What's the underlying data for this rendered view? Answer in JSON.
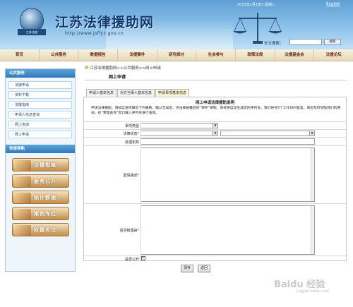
{
  "header": {
    "site_title": "江苏法律援助网",
    "site_url": "http://www.jsflyz.gov.cn",
    "emblem_text": "江苏法援",
    "date_text": "2011年1月18日 星期二",
    "lang_link": "English",
    "search_label": "全文搜索：",
    "search_value": "",
    "search_button": "搜索"
  },
  "nav": {
    "items": [
      "首页",
      "公共服务",
      "数据报告",
      "法援案件",
      "研究探讨",
      "社会参与",
      "政策法规",
      "法援基金会",
      "法援论坛"
    ]
  },
  "sidebar": {
    "public_service_title": "公共服务",
    "items": [
      "法援申请",
      "资料下载",
      "法援指南",
      "申请人信息查询",
      "网上咨询",
      "网上申请"
    ],
    "quick_nav_title": "快速导航",
    "quick_buttons": [
      "法援指南",
      "服务公开",
      "统计数据",
      "案例专栏",
      "权援关注"
    ]
  },
  "main": {
    "breadcrumb": "江苏法律援助网>>公共服务>>网上申请",
    "page_title": "网上申请",
    "tabs": [
      "申请人基本信息",
      "对方当事人基本信息",
      "申请事项基本信息"
    ],
    "active_tab_index": 2,
    "form_heading": "网上申请法律援助说明",
    "form_notice": "申请法律援助，请如实逐项填写下列表格，确认无误后，点击表格最后的“保存”按钮。系统将自动生成您的序列号，我们将在5个工作日内答复，请您及时登陆我们的网站，在“受理查询”窗口输入序列号进行查询。",
    "fields": {
      "matter_type_label": "事项类型",
      "legal_status_label": "法律状态",
      "handling_org_label": "处理机构",
      "case_description_label": "案情描述",
      "request_reason_label": "请求和理由",
      "public_label": "是否公开"
    },
    "public_checked": true,
    "buttons": {
      "save": "保存",
      "back": "返回"
    }
  },
  "watermark": {
    "text": "Baidu 经验",
    "sub": "jingyan.baidu.com"
  },
  "colors": {
    "header_blue": "#5f9fd4",
    "nav_text": "#6a2a12",
    "sidebar_head": "#2f79bb",
    "required": "#d40000"
  }
}
